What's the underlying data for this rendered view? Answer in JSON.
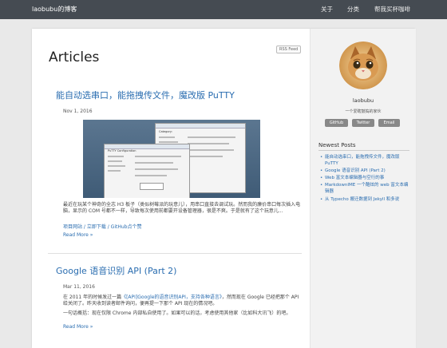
{
  "header": {
    "brand": "laobubu的博客",
    "nav": [
      "关于",
      "分类",
      "帮我买杯咖啡"
    ]
  },
  "page": {
    "title": "Articles",
    "rss_label": "RSS Feed"
  },
  "posts": [
    {
      "title": "能自动选串口，能拖拽传文件，魔改版 PuTTY",
      "date": "Nov 1, 2016",
      "excerpt": "最近在玩某个神奇的全志 H3 板子（类似树莓派的玩意儿），用串口直接去调试玩。然而我的廉价串口每次插入电脑，显示的 COM 号都不一样，导致每次使用前都要开设备管理器，很是不爽。于是就有了这个玩意儿...",
      "links": "项目网站 / 立即下载 / GitHub点个赞",
      "read_more": "Read More »"
    },
    {
      "title": "Google 语音识别 API (Part 2)",
      "date": "Mar 11, 2016",
      "excerpt_before": "在 2011 年的时候发过一篇",
      "excerpt_link": "《[API]Google的语音识别API，支持各种语言》",
      "excerpt_after": "，然而现在 Google 已经把那个 API 给关闭了。昨天收到读者邮件询问，便再提一下那个 API 现在的情况吧。",
      "excerpt2": "一句话概括：现在仅限 Chrome 内部私自使用了。如果可以的话，考虑使用其他家（比如科大讯飞）的吧。",
      "read_more": "Read More »"
    }
  ],
  "sidebar": {
    "author": "laobubu",
    "bio": "一个爱瞎鼓捣的家伙",
    "buttons": [
      "GitHub",
      "Twitter",
      "Email"
    ],
    "recent_title": "Newest Posts",
    "recent": [
      "能自动选串口，能拖拽传文件，魔改版 PuTTY",
      "Google 语音识别 API (Part 2)",
      "Web 富文本编辑器与空行的事",
      "MarkdownIME 一个酷炫的 web 富文本编辑器",
      "从 Typecho 搬迁数据到 Jekyll 和多说"
    ]
  },
  "screenshot": {
    "window_title": "PuTTY Configuration",
    "category_label": "Category:"
  },
  "colors": {
    "link": "#2a6db0",
    "topbar": "#454b52",
    "background": "#e9e9e9",
    "sidebar": "#f2f2f2"
  }
}
